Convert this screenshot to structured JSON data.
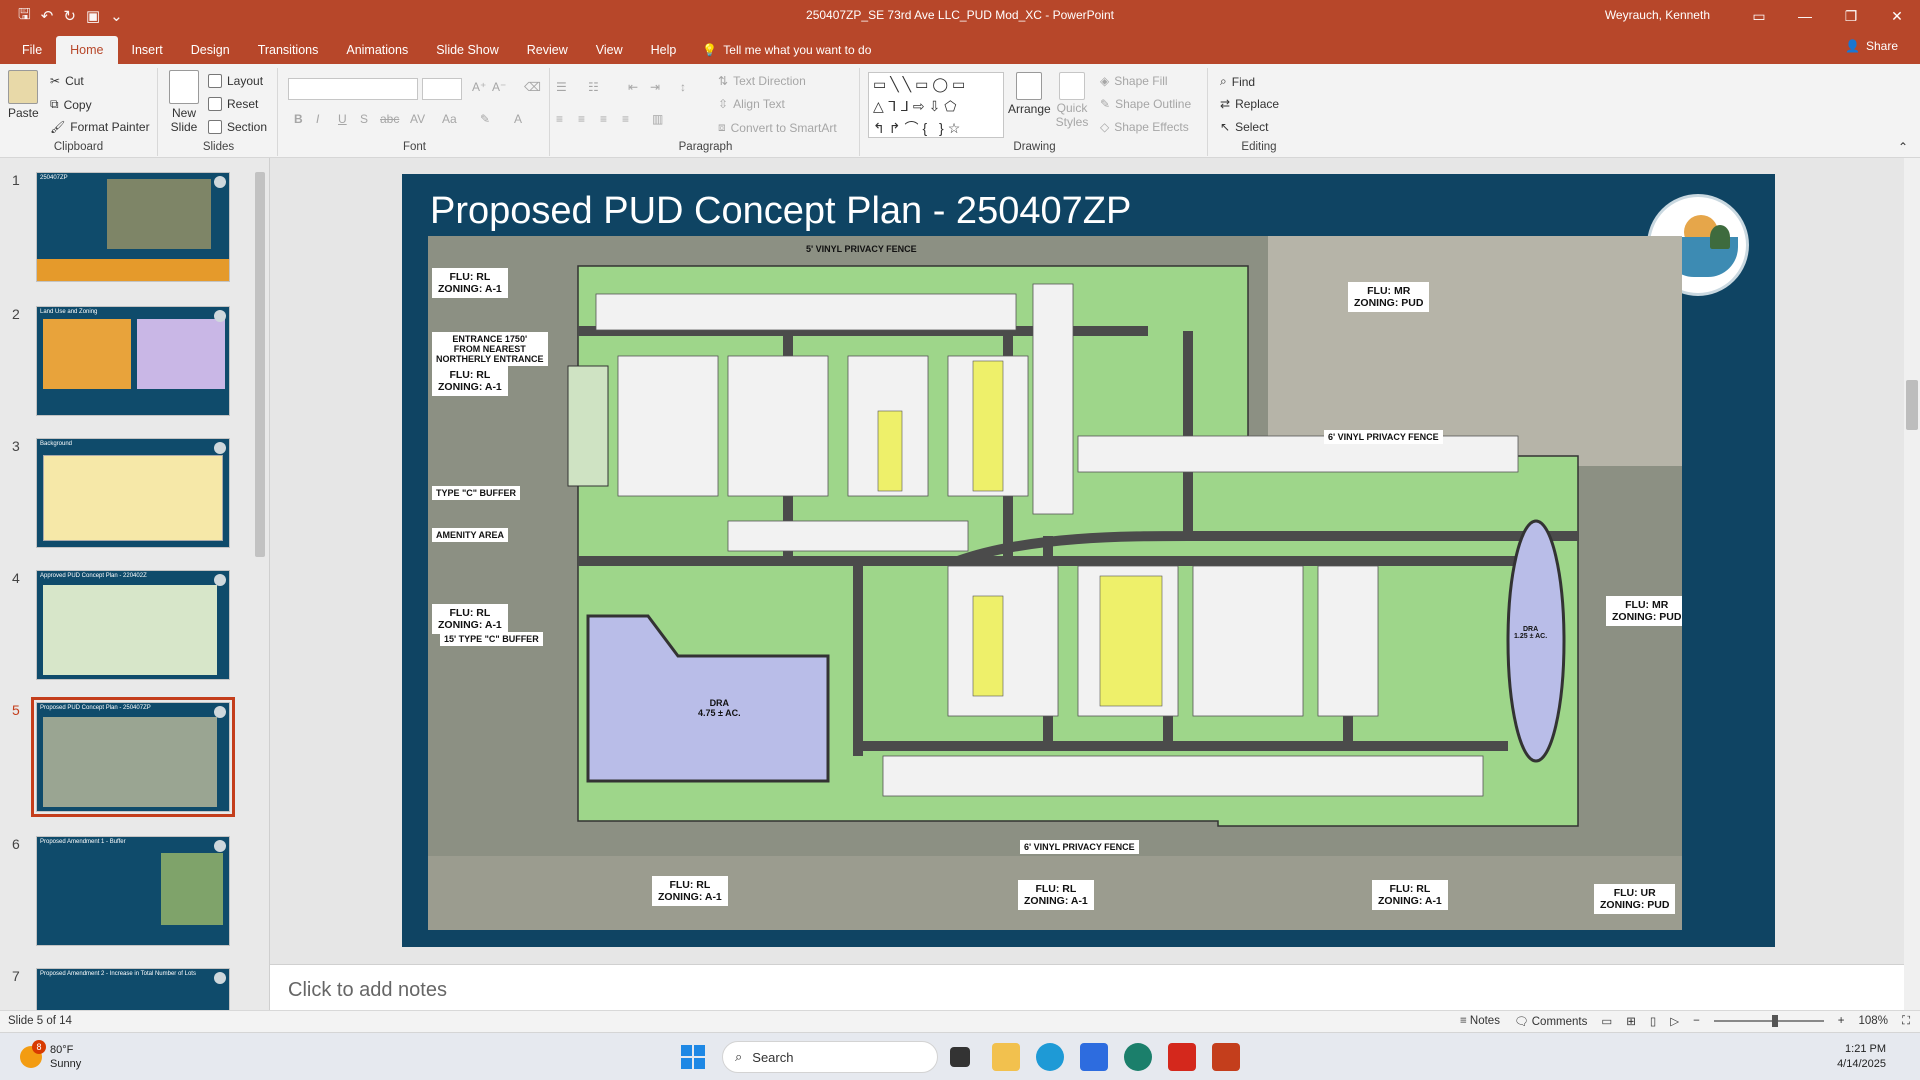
{
  "window": {
    "doc_title": "250407ZP_SE 73rd Ave LLC_PUD Mod_XC  -  PowerPoint",
    "user": "Weyrauch, Kenneth"
  },
  "tabs": [
    "File",
    "Home",
    "Insert",
    "Design",
    "Transitions",
    "Animations",
    "Slide Show",
    "Review",
    "View",
    "Help"
  ],
  "active_tab": "Home",
  "tell_me": "Tell me what you want to do",
  "share": "Share",
  "ribbon": {
    "clipboard": {
      "label": "Clipboard",
      "paste": "Paste",
      "cut": "Cut",
      "copy": "Copy",
      "format_painter": "Format Painter"
    },
    "slides": {
      "label": "Slides",
      "new_slide": "New Slide",
      "layout": "Layout",
      "reset": "Reset",
      "section": "Section"
    },
    "font": {
      "label": "Font"
    },
    "paragraph": {
      "label": "Paragraph",
      "text_direction": "Text Direction",
      "align_text": "Align Text",
      "convert_smartart": "Convert to SmartArt"
    },
    "drawing": {
      "label": "Drawing",
      "arrange": "Arrange",
      "quick_styles": "Quick Styles",
      "shape_fill": "Shape Fill",
      "shape_outline": "Shape Outline",
      "shape_effects": "Shape Effects"
    },
    "editing": {
      "label": "Editing",
      "find": "Find",
      "replace": "Replace",
      "select": "Select"
    }
  },
  "thumbnails": [
    {
      "num": "1",
      "title": "250407ZP"
    },
    {
      "num": "2",
      "title": "Land Use and Zoning"
    },
    {
      "num": "3",
      "title": "Background"
    },
    {
      "num": "4",
      "title": "Approved PUD Concept Plan - 220402Z"
    },
    {
      "num": "5",
      "title": "Proposed PUD Concept Plan - 250407ZP"
    },
    {
      "num": "6",
      "title": "Proposed Amendment 1 - Buffer"
    },
    {
      "num": "7",
      "title": "Proposed Amendment 2 - Increase in Total Number of Lots"
    }
  ],
  "slide": {
    "title": "Proposed PUD Concept Plan - 250407ZP",
    "zones": {
      "z1": "FLU: RL\nZONING: A-1",
      "z2": "FLU: RL\nZONING: A-1",
      "z3": "FLU: RL\nZONING: A-1",
      "z4": "FLU: MR\nZONING: PUD",
      "z5": "FLU: MR\nZONING: PUD",
      "z6": "FLU: RL\nZONING: A-1",
      "z7": "FLU: RL\nZONING: A-1",
      "z8": "FLU: RL\nZONING: A-1",
      "z9": "FLU: UR\nZONING: PUD"
    },
    "annotations": {
      "fence_top": "5' VINYL PRIVACY FENCE",
      "entrance": "ENTRANCE 1750'\nFROM NEAREST\nNORTHERLY ENTRANCE",
      "buffer_c": "TYPE \"C\" BUFFER",
      "amenity": "AMENITY AREA",
      "buffer_15": "15' TYPE \"C\" BUFFER",
      "fence_mid": "6' VINYL PRIVACY FENCE",
      "fence_bottom": "6' VINYL PRIVACY FENCE",
      "dra_main": "DRA\n4.75 ± AC.",
      "dra_east": "DRA\n1.25 ± AC."
    }
  },
  "notes_placeholder": "Click to add notes",
  "status": {
    "slide_info": "Slide 5 of 14",
    "notes": "Notes",
    "comments": "Comments",
    "zoom": "108%"
  },
  "taskbar": {
    "temp": "80°F",
    "condition": "Sunny",
    "badge": "8",
    "search": "Search",
    "time": "1:21 PM",
    "date": "4/14/2025"
  },
  "colors": {
    "accent": "#b7472a",
    "slide_bg": "#0f4463"
  }
}
